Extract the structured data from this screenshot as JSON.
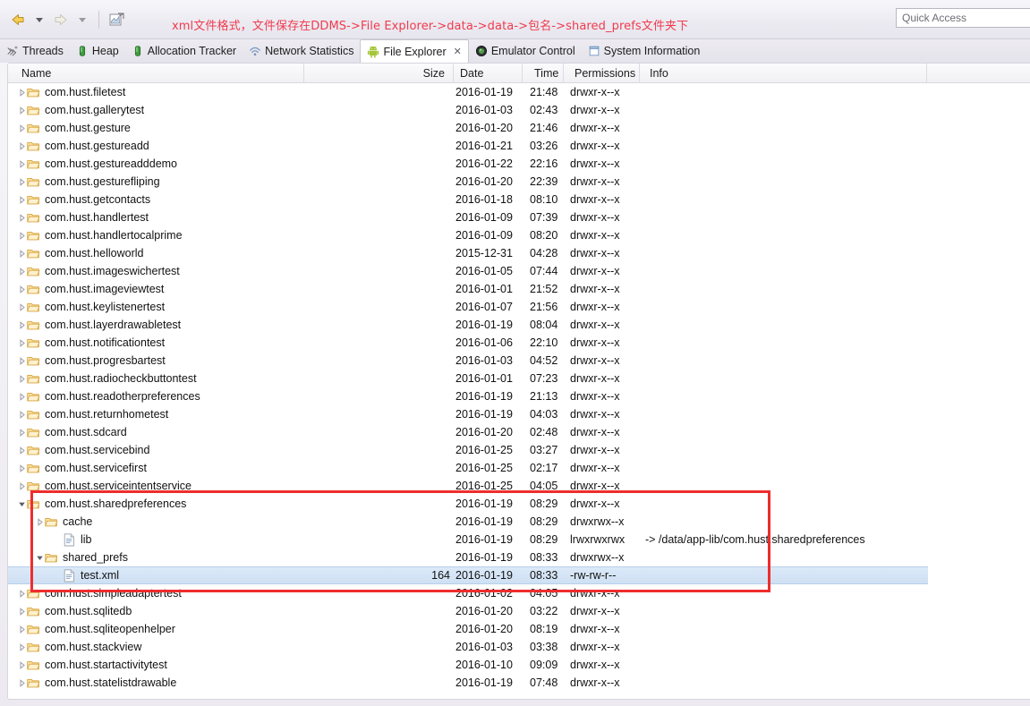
{
  "toolbar": {
    "back_label": "Back",
    "back_dropdown_label": "Back history",
    "forward_label": "Forward",
    "forward_dropdown_label": "Forward history",
    "new_label": "New",
    "annotation": "xml文件格式，文件保存在DDMS->File Explorer->data->data->包名->shared_prefs文件夹下",
    "annotation_color": "#ef3b4e",
    "quick_access_placeholder": "Quick Access",
    "quick_access_value": ""
  },
  "tabs": [
    {
      "label": "Threads",
      "icon": "threads-icon",
      "active": false
    },
    {
      "label": "Heap",
      "icon": "heap-icon",
      "active": false
    },
    {
      "label": "Allocation Tracker",
      "icon": "allocation-tracker-icon",
      "active": false
    },
    {
      "label": "Network Statistics",
      "icon": "network-statistics-icon",
      "active": false
    },
    {
      "label": "File Explorer",
      "icon": "android-icon",
      "active": true,
      "close": "✕"
    },
    {
      "label": "Emulator Control",
      "icon": "emulator-control-icon",
      "active": false
    },
    {
      "label": "System Information",
      "icon": "system-information-icon",
      "active": false
    }
  ],
  "columns": [
    {
      "key": "name",
      "label": "Name",
      "align": "left"
    },
    {
      "key": "size",
      "label": "Size",
      "align": "right"
    },
    {
      "key": "date",
      "label": "Date",
      "align": "left"
    },
    {
      "key": "time",
      "label": "Time",
      "align": "left"
    },
    {
      "key": "permissions",
      "label": "Permissions",
      "align": "left"
    },
    {
      "key": "info",
      "label": "Info",
      "align": "left"
    }
  ],
  "rows": [
    {
      "name": "com.hust.filetest",
      "indent": 1,
      "twisty": "collapsed",
      "icon": "folder-icon",
      "size": "",
      "date": "2016-01-19",
      "time": "21:48",
      "permissions": "drwxr-x--x",
      "info": ""
    },
    {
      "name": "com.hust.gallerytest",
      "indent": 1,
      "twisty": "collapsed",
      "icon": "folder-icon",
      "size": "",
      "date": "2016-01-03",
      "time": "02:43",
      "permissions": "drwxr-x--x",
      "info": ""
    },
    {
      "name": "com.hust.gesture",
      "indent": 1,
      "twisty": "collapsed",
      "icon": "folder-icon",
      "size": "",
      "date": "2016-01-20",
      "time": "21:46",
      "permissions": "drwxr-x--x",
      "info": ""
    },
    {
      "name": "com.hust.gestureadd",
      "indent": 1,
      "twisty": "collapsed",
      "icon": "folder-icon",
      "size": "",
      "date": "2016-01-21",
      "time": "03:26",
      "permissions": "drwxr-x--x",
      "info": ""
    },
    {
      "name": "com.hust.gestureadddemo",
      "indent": 1,
      "twisty": "collapsed",
      "icon": "folder-icon",
      "size": "",
      "date": "2016-01-22",
      "time": "22:16",
      "permissions": "drwxr-x--x",
      "info": ""
    },
    {
      "name": "com.hust.gesturefliping",
      "indent": 1,
      "twisty": "collapsed",
      "icon": "folder-icon",
      "size": "",
      "date": "2016-01-20",
      "time": "22:39",
      "permissions": "drwxr-x--x",
      "info": ""
    },
    {
      "name": "com.hust.getcontacts",
      "indent": 1,
      "twisty": "collapsed",
      "icon": "folder-icon",
      "size": "",
      "date": "2016-01-18",
      "time": "08:10",
      "permissions": "drwxr-x--x",
      "info": ""
    },
    {
      "name": "com.hust.handlertest",
      "indent": 1,
      "twisty": "collapsed",
      "icon": "folder-icon",
      "size": "",
      "date": "2016-01-09",
      "time": "07:39",
      "permissions": "drwxr-x--x",
      "info": ""
    },
    {
      "name": "com.hust.handlertocalprime",
      "indent": 1,
      "twisty": "collapsed",
      "icon": "folder-icon",
      "size": "",
      "date": "2016-01-09",
      "time": "08:20",
      "permissions": "drwxr-x--x",
      "info": ""
    },
    {
      "name": "com.hust.helloworld",
      "indent": 1,
      "twisty": "collapsed",
      "icon": "folder-icon",
      "size": "",
      "date": "2015-12-31",
      "time": "04:28",
      "permissions": "drwxr-x--x",
      "info": ""
    },
    {
      "name": "com.hust.imageswichertest",
      "indent": 1,
      "twisty": "collapsed",
      "icon": "folder-icon",
      "size": "",
      "date": "2016-01-05",
      "time": "07:44",
      "permissions": "drwxr-x--x",
      "info": ""
    },
    {
      "name": "com.hust.imageviewtest",
      "indent": 1,
      "twisty": "collapsed",
      "icon": "folder-icon",
      "size": "",
      "date": "2016-01-01",
      "time": "21:52",
      "permissions": "drwxr-x--x",
      "info": ""
    },
    {
      "name": "com.hust.keylistenertest",
      "indent": 1,
      "twisty": "collapsed",
      "icon": "folder-icon",
      "size": "",
      "date": "2016-01-07",
      "time": "21:56",
      "permissions": "drwxr-x--x",
      "info": ""
    },
    {
      "name": "com.hust.layerdrawabletest",
      "indent": 1,
      "twisty": "collapsed",
      "icon": "folder-icon",
      "size": "",
      "date": "2016-01-19",
      "time": "08:04",
      "permissions": "drwxr-x--x",
      "info": ""
    },
    {
      "name": "com.hust.notificationtest",
      "indent": 1,
      "twisty": "collapsed",
      "icon": "folder-icon",
      "size": "",
      "date": "2016-01-06",
      "time": "22:10",
      "permissions": "drwxr-x--x",
      "info": ""
    },
    {
      "name": "com.hust.progresbartest",
      "indent": 1,
      "twisty": "collapsed",
      "icon": "folder-icon",
      "size": "",
      "date": "2016-01-03",
      "time": "04:52",
      "permissions": "drwxr-x--x",
      "info": ""
    },
    {
      "name": "com.hust.radiocheckbuttontest",
      "indent": 1,
      "twisty": "collapsed",
      "icon": "folder-icon",
      "size": "",
      "date": "2016-01-01",
      "time": "07:23",
      "permissions": "drwxr-x--x",
      "info": ""
    },
    {
      "name": "com.hust.readotherpreferences",
      "indent": 1,
      "twisty": "collapsed",
      "icon": "folder-icon",
      "size": "",
      "date": "2016-01-19",
      "time": "21:13",
      "permissions": "drwxr-x--x",
      "info": ""
    },
    {
      "name": "com.hust.returnhometest",
      "indent": 1,
      "twisty": "collapsed",
      "icon": "folder-icon",
      "size": "",
      "date": "2016-01-19",
      "time": "04:03",
      "permissions": "drwxr-x--x",
      "info": ""
    },
    {
      "name": "com.hust.sdcard",
      "indent": 1,
      "twisty": "collapsed",
      "icon": "folder-icon",
      "size": "",
      "date": "2016-01-20",
      "time": "02:48",
      "permissions": "drwxr-x--x",
      "info": ""
    },
    {
      "name": "com.hust.servicebind",
      "indent": 1,
      "twisty": "collapsed",
      "icon": "folder-icon",
      "size": "",
      "date": "2016-01-25",
      "time": "03:27",
      "permissions": "drwxr-x--x",
      "info": ""
    },
    {
      "name": "com.hust.servicefirst",
      "indent": 1,
      "twisty": "collapsed",
      "icon": "folder-icon",
      "size": "",
      "date": "2016-01-25",
      "time": "02:17",
      "permissions": "drwxr-x--x",
      "info": ""
    },
    {
      "name": "com.hust.serviceintentservice",
      "indent": 1,
      "twisty": "collapsed",
      "icon": "folder-icon",
      "size": "",
      "date": "2016-01-25",
      "time": "04:05",
      "permissions": "drwxr-x--x",
      "info": ""
    },
    {
      "name": "com.hust.sharedpreferences",
      "indent": 1,
      "twisty": "expanded",
      "icon": "folder-icon",
      "size": "",
      "date": "2016-01-19",
      "time": "08:29",
      "permissions": "drwxr-x--x",
      "info": ""
    },
    {
      "name": "cache",
      "indent": 2,
      "twisty": "collapsed",
      "icon": "folder-icon",
      "size": "",
      "date": "2016-01-19",
      "time": "08:29",
      "permissions": "drwxrwx--x",
      "info": ""
    },
    {
      "name": "lib",
      "indent": 3,
      "twisty": "none",
      "icon": "file-icon",
      "size": "",
      "date": "2016-01-19",
      "time": "08:29",
      "permissions": "lrwxrwxrwx",
      "info": "-> /data/app-lib/com.hust.sharedpreferences"
    },
    {
      "name": "shared_prefs",
      "indent": 2,
      "twisty": "expanded",
      "icon": "folder-icon",
      "size": "",
      "date": "2016-01-19",
      "time": "08:33",
      "permissions": "drwxrwx--x",
      "info": ""
    },
    {
      "name": "test.xml",
      "indent": 3,
      "twisty": "none",
      "icon": "file-icon",
      "size": "164",
      "date": "2016-01-19",
      "time": "08:33",
      "permissions": "-rw-rw-r--",
      "info": "",
      "selected": true
    },
    {
      "name": "com.hust.simpleadaptertest",
      "indent": 1,
      "twisty": "collapsed",
      "icon": "folder-icon",
      "size": "",
      "date": "2016-01-02",
      "time": "04:05",
      "permissions": "drwxr-x--x",
      "info": ""
    },
    {
      "name": "com.hust.sqlitedb",
      "indent": 1,
      "twisty": "collapsed",
      "icon": "folder-icon",
      "size": "",
      "date": "2016-01-20",
      "time": "03:22",
      "permissions": "drwxr-x--x",
      "info": ""
    },
    {
      "name": "com.hust.sqliteopenhelper",
      "indent": 1,
      "twisty": "collapsed",
      "icon": "folder-icon",
      "size": "",
      "date": "2016-01-20",
      "time": "08:19",
      "permissions": "drwxr-x--x",
      "info": ""
    },
    {
      "name": "com.hust.stackview",
      "indent": 1,
      "twisty": "collapsed",
      "icon": "folder-icon",
      "size": "",
      "date": "2016-01-03",
      "time": "03:38",
      "permissions": "drwxr-x--x",
      "info": ""
    },
    {
      "name": "com.hust.startactivitytest",
      "indent": 1,
      "twisty": "collapsed",
      "icon": "folder-icon",
      "size": "",
      "date": "2016-01-10",
      "time": "09:09",
      "permissions": "drwxr-x--x",
      "info": ""
    },
    {
      "name": "com.hust.statelistdrawable",
      "indent": 1,
      "twisty": "collapsed",
      "icon": "folder-icon",
      "size": "",
      "date": "2016-01-19",
      "time": "07:48",
      "permissions": "drwxr-x--x",
      "info": ""
    }
  ],
  "highlight": {
    "color": "#ee2d2d",
    "label": "shared_prefs highlight box"
  }
}
